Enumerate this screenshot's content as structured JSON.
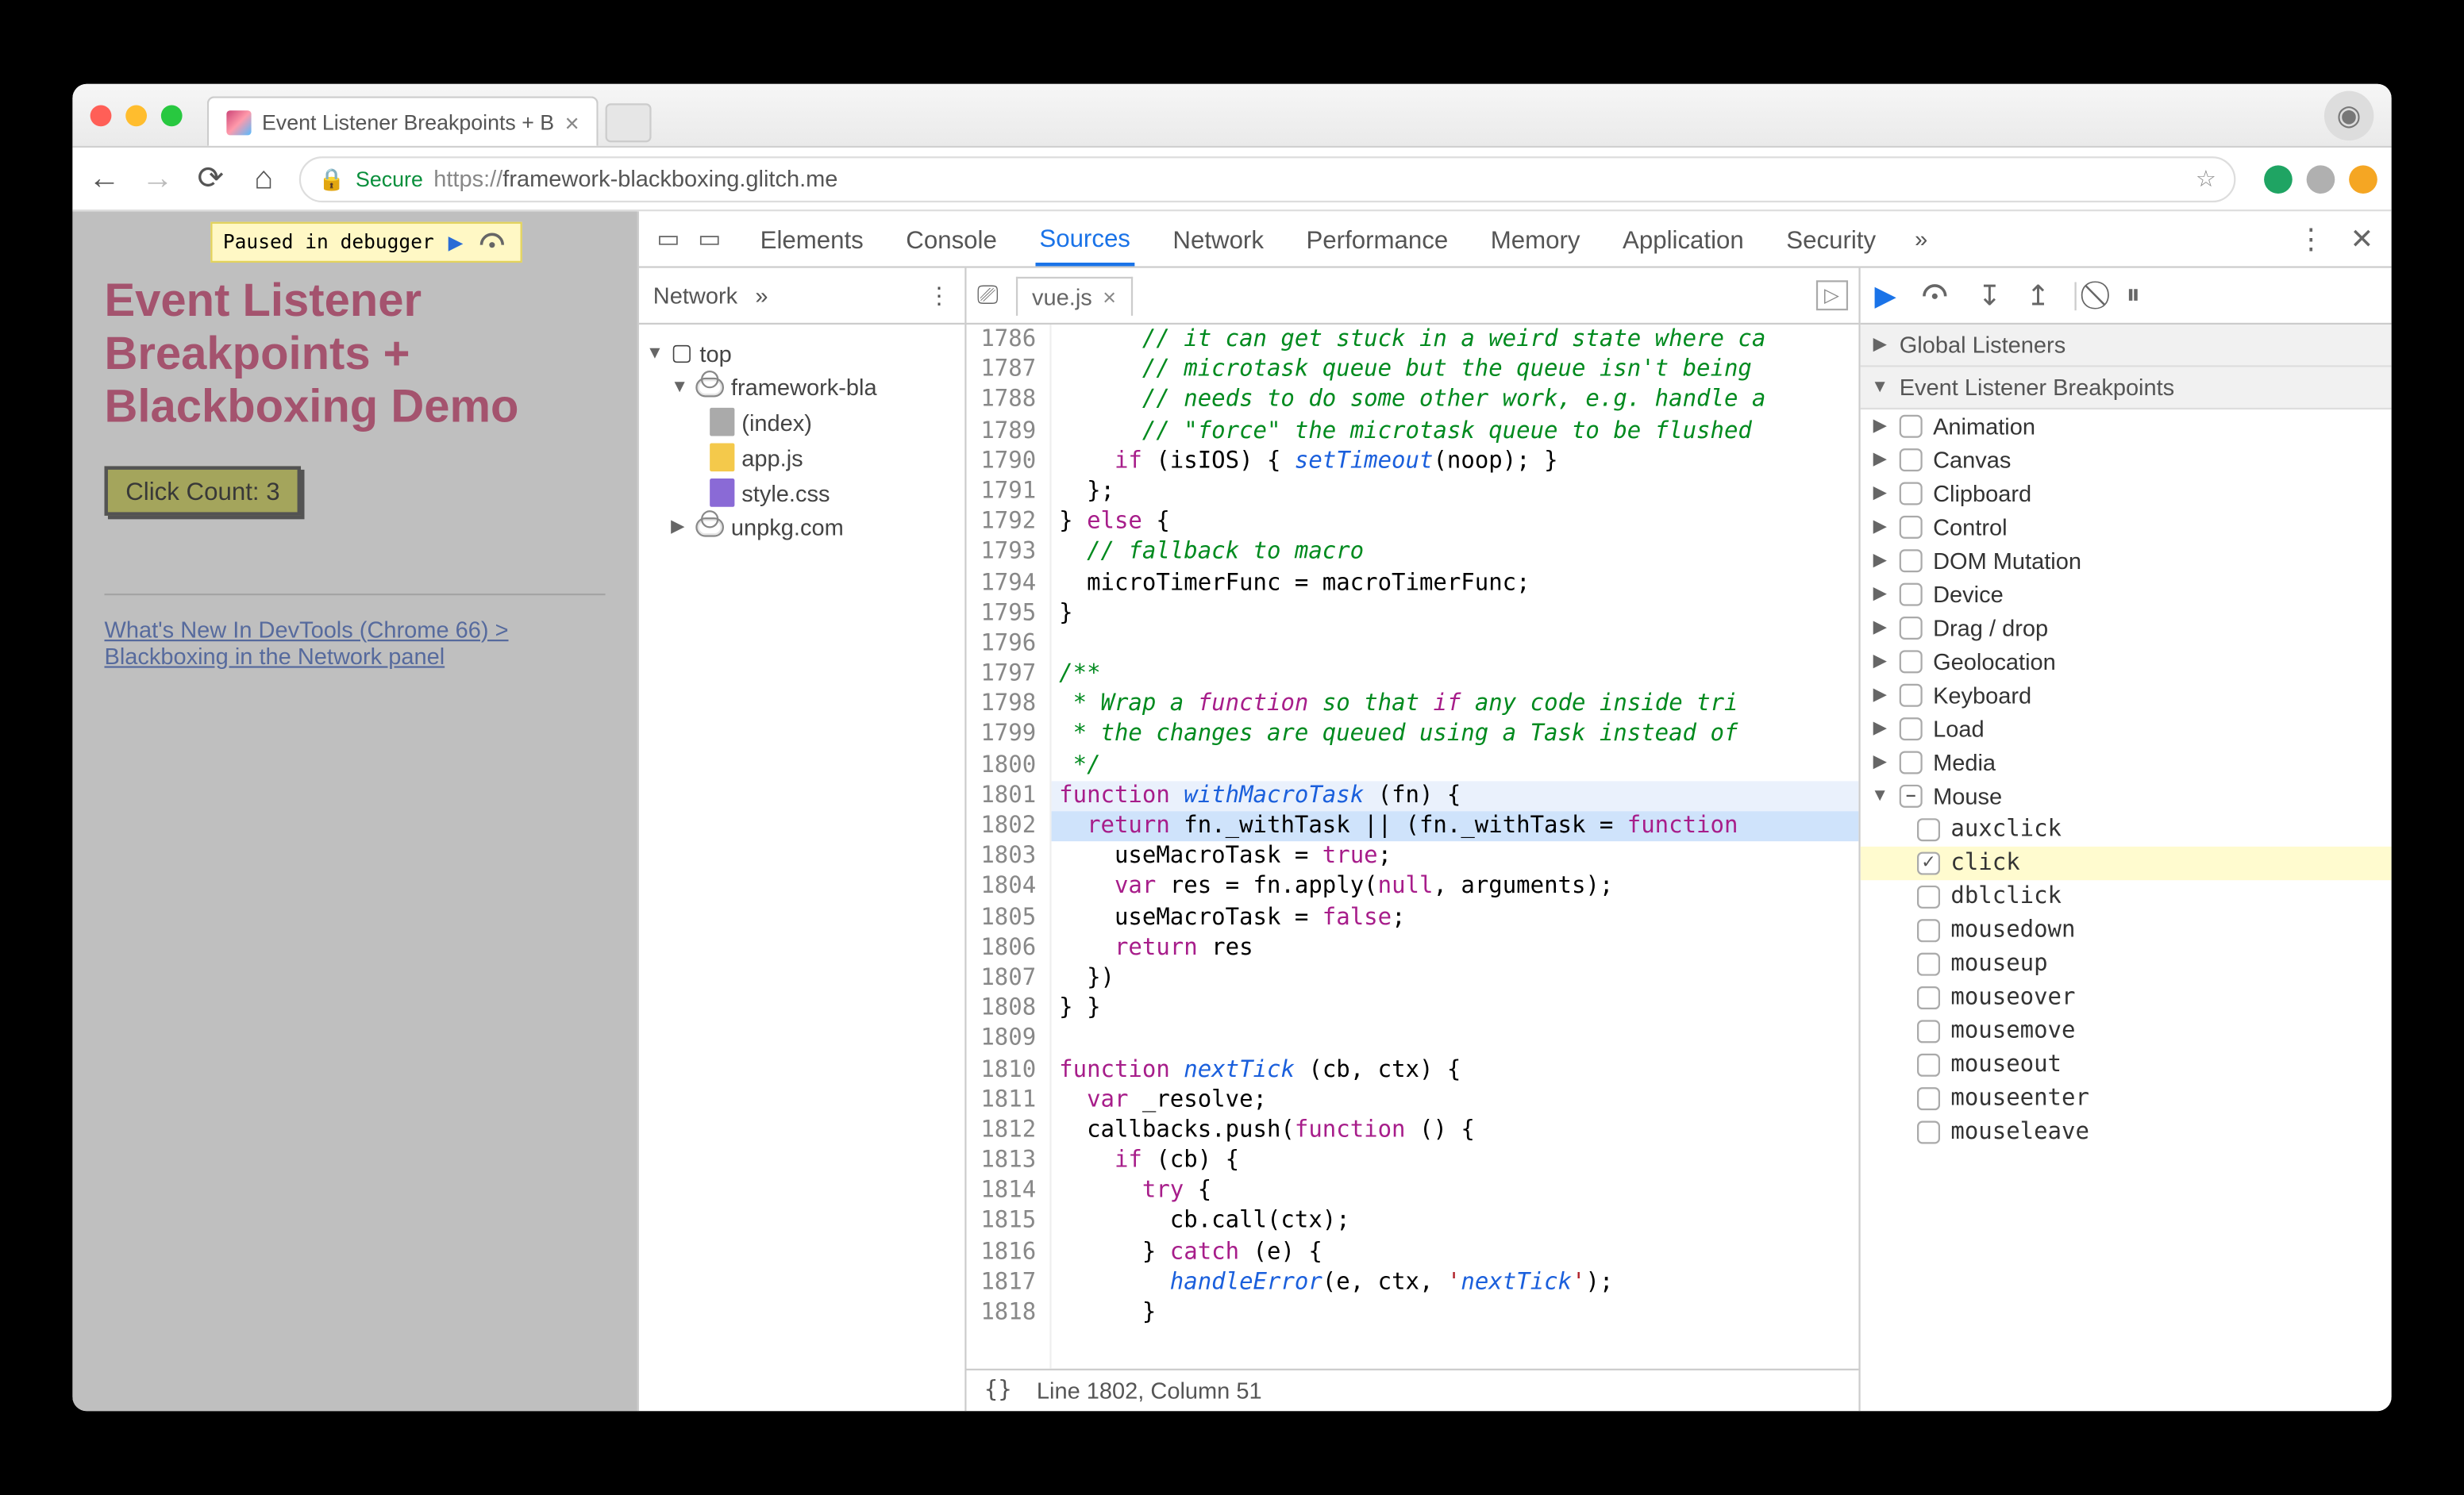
{
  "browser": {
    "tab_title": "Event Listener Breakpoints + B",
    "secure_label": "Secure",
    "url_prefix": "https://",
    "url_rest": "framework-blackboxing.glitch.me"
  },
  "page": {
    "paused_label": "Paused in debugger",
    "heading": "Event Listener Breakpoints + Blackboxing Demo",
    "button_label": "Click Count: 3",
    "link_text": "What's New In DevTools (Chrome 66) > Blackboxing in the Network panel"
  },
  "devtools": {
    "tabs": [
      "Elements",
      "Console",
      "Sources",
      "Network",
      "Performance",
      "Memory",
      "Application",
      "Security"
    ],
    "tabs_more": "»",
    "active_tab": "Sources",
    "navigator": {
      "toolbar_label": "Network",
      "toolbar_more": "»",
      "tree": {
        "top": "top",
        "domain": "framework-bla",
        "files": [
          "(index)",
          "app.js",
          "style.css"
        ],
        "external": "unpkg.com"
      }
    },
    "editor": {
      "file_tab": "vue.js",
      "status": "Line 1802, Column 51",
      "lines_start": 1786,
      "lines_end": 1818,
      "code": [
        "      // it can get stuck in a weird state where ca",
        "      // microtask queue but the queue isn't being",
        "      // needs to do some other work, e.g. handle a",
        "      // \"force\" the microtask queue to be flushed",
        "    if (isIOS) { setTimeout(noop); }",
        "  };",
        "} else {",
        "  // fallback to macro",
        "  microTimerFunc = macroTimerFunc;",
        "}",
        "",
        "/**",
        " * Wrap a function so that if any code inside tri",
        " * the changes are queued using a Task instead of",
        " */",
        "function withMacroTask (fn) {",
        "  return fn._withTask || (fn._withTask = function",
        "    useMacroTask = true;",
        "    var res = fn.apply(null, arguments);",
        "    useMacroTask = false;",
        "    return res",
        "  })",
        "} }",
        "",
        "function nextTick (cb, ctx) {",
        "  var _resolve;",
        "  callbacks.push(function () {",
        "    if (cb) {",
        "      try {",
        "        cb.call(ctx);",
        "      } catch (e) {",
        "        handleError(e, ctx, 'nextTick');",
        "      }"
      ]
    },
    "debugger": {
      "sections": {
        "global_listeners": "Global Listeners",
        "event_bp": "Event Listener Breakpoints"
      },
      "categories": [
        {
          "name": "Animation",
          "state": "unchecked",
          "open": false
        },
        {
          "name": "Canvas",
          "state": "unchecked",
          "open": false
        },
        {
          "name": "Clipboard",
          "state": "unchecked",
          "open": false
        },
        {
          "name": "Control",
          "state": "unchecked",
          "open": false
        },
        {
          "name": "DOM Mutation",
          "state": "unchecked",
          "open": false
        },
        {
          "name": "Device",
          "state": "unchecked",
          "open": false
        },
        {
          "name": "Drag / drop",
          "state": "unchecked",
          "open": false
        },
        {
          "name": "Geolocation",
          "state": "unchecked",
          "open": false
        },
        {
          "name": "Keyboard",
          "state": "unchecked",
          "open": false
        },
        {
          "name": "Load",
          "state": "unchecked",
          "open": false
        },
        {
          "name": "Media",
          "state": "unchecked",
          "open": false
        },
        {
          "name": "Mouse",
          "state": "mixed",
          "open": true,
          "children": [
            {
              "name": "auxclick",
              "checked": false
            },
            {
              "name": "click",
              "checked": true,
              "highlight": true
            },
            {
              "name": "dblclick",
              "checked": false
            },
            {
              "name": "mousedown",
              "checked": false
            },
            {
              "name": "mouseup",
              "checked": false
            },
            {
              "name": "mouseover",
              "checked": false
            },
            {
              "name": "mousemove",
              "checked": false
            },
            {
              "name": "mouseout",
              "checked": false
            },
            {
              "name": "mouseenter",
              "checked": false
            },
            {
              "name": "mouseleave",
              "checked": false
            }
          ]
        }
      ]
    }
  }
}
